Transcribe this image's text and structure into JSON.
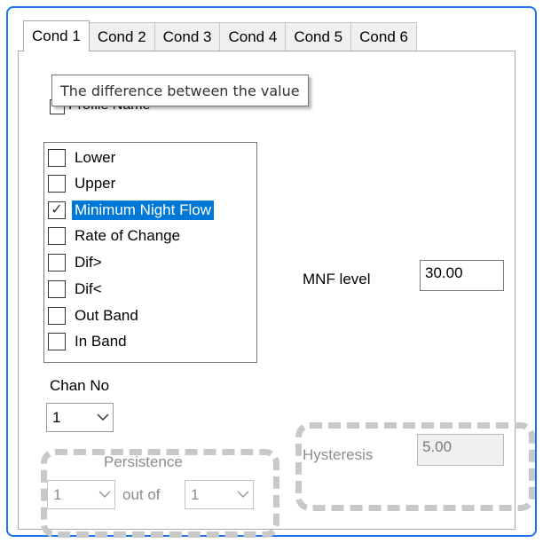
{
  "tabs": [
    {
      "label": "Cond 1",
      "active": true
    },
    {
      "label": "Cond 2",
      "active": false
    },
    {
      "label": "Cond 3",
      "active": false
    },
    {
      "label": "Cond 4",
      "active": false
    },
    {
      "label": "Cond 5",
      "active": false
    },
    {
      "label": "Cond 6",
      "active": false
    }
  ],
  "tooltip": {
    "text": "The difference between the value"
  },
  "profile_name": {
    "label": "Profile Name",
    "checked": false
  },
  "conditions": [
    {
      "label": "Lower",
      "checked": false,
      "selected": false
    },
    {
      "label": "Upper",
      "checked": false,
      "selected": false
    },
    {
      "label": "Minimum Night Flow",
      "checked": true,
      "selected": true
    },
    {
      "label": "Rate of Change",
      "checked": false,
      "selected": false
    },
    {
      "label": "Dif>",
      "checked": false,
      "selected": false
    },
    {
      "label": "Dif<",
      "checked": false,
      "selected": false
    },
    {
      "label": "Out Band",
      "checked": false,
      "selected": false
    },
    {
      "label": "In Band",
      "checked": false,
      "selected": false
    }
  ],
  "mnf": {
    "label": "MNF level",
    "value": "30.00"
  },
  "chan": {
    "label": "Chan No",
    "value": "1"
  },
  "persistence": {
    "label": "Persistence",
    "value_a": "1",
    "out_of_label": "out of",
    "value_b": "1",
    "enabled": false
  },
  "hysteresis": {
    "label": "Hysteresis",
    "value": "5.00",
    "enabled": false
  },
  "colors": {
    "accent_border": "#1a73e8",
    "selection": "#0078d7",
    "highlight_dash": "#c8c8c8"
  },
  "icons": {
    "checkmark": "check-icon",
    "dropdown": "chevron-down-icon"
  }
}
